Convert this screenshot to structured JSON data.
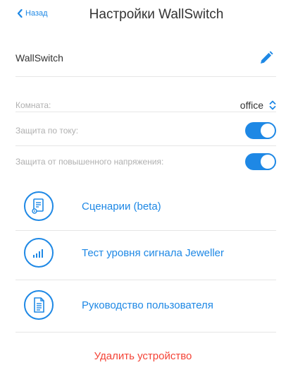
{
  "header": {
    "back_label": "Назад",
    "title": "Настройки WallSwitch"
  },
  "device": {
    "name": "WallSwitch",
    "edit_icon": "pencil-icon"
  },
  "settings": {
    "room_label": "Комната:",
    "room_value": "office",
    "current_protection_label": "Защита по току:",
    "current_protection_on": true,
    "overvoltage_protection_label": "Защита от повышенного напряжения:",
    "overvoltage_protection_on": true
  },
  "menu": [
    {
      "label": "Сценарии (beta)",
      "icon": "scenarios-icon"
    },
    {
      "label": "Тест уровня сигнала Jeweller",
      "icon": "signal-bars-icon"
    },
    {
      "label": "Руководство пользователя",
      "icon": "document-icon"
    }
  ],
  "delete_label": "Удалить устройство",
  "colors": {
    "accent": "#1e88e5",
    "danger": "#f44336",
    "muted_text": "#b0b0b0",
    "divider": "#e6e6e6"
  }
}
